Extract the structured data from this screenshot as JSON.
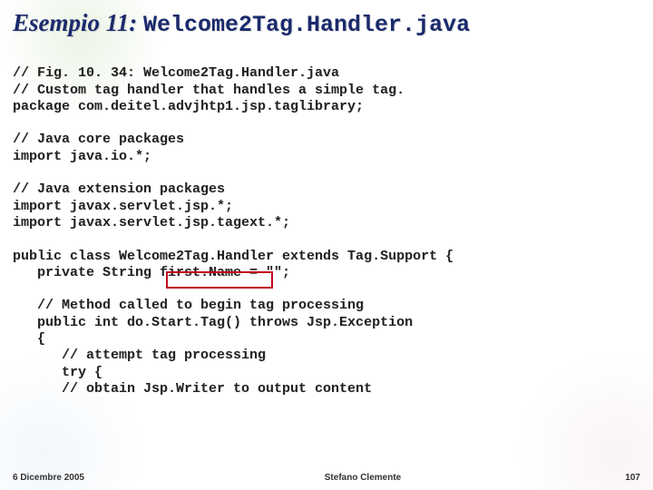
{
  "title": {
    "prefix": "Esempio 11:",
    "filename": "Welcome2Tag.Handler.java"
  },
  "code": {
    "l01": "// Fig. 10. 34: Welcome2Tag.Handler.java",
    "l02": "// Custom tag handler that handles a simple tag.",
    "l03": "package com.deitel.advjhtp1.jsp.taglibrary;",
    "l04": "",
    "l05": "// Java core packages",
    "l06": "import java.io.*;",
    "l07": "",
    "l08": "// Java extension packages",
    "l09": "import javax.servlet.jsp.*;",
    "l10": "import javax.servlet.jsp.tagext.*;",
    "l11": "",
    "l12": "public class Welcome2Tag.Handler extends Tag.Support {",
    "l13": "   private String first.Name = \"\";",
    "l14": "",
    "l15": "   // Method called to begin tag processing",
    "l16": "   public int do.Start.Tag() throws Jsp.Exception",
    "l17": "   {",
    "l18": "      // attempt tag processing",
    "l19": "      try {",
    "l20": "      // obtain Jsp.Writer to output content"
  },
  "highlight": {
    "label": "first.Name"
  },
  "footer": {
    "date": "6 Dicembre 2005",
    "author": "Stefano Clemente",
    "page": "107"
  }
}
